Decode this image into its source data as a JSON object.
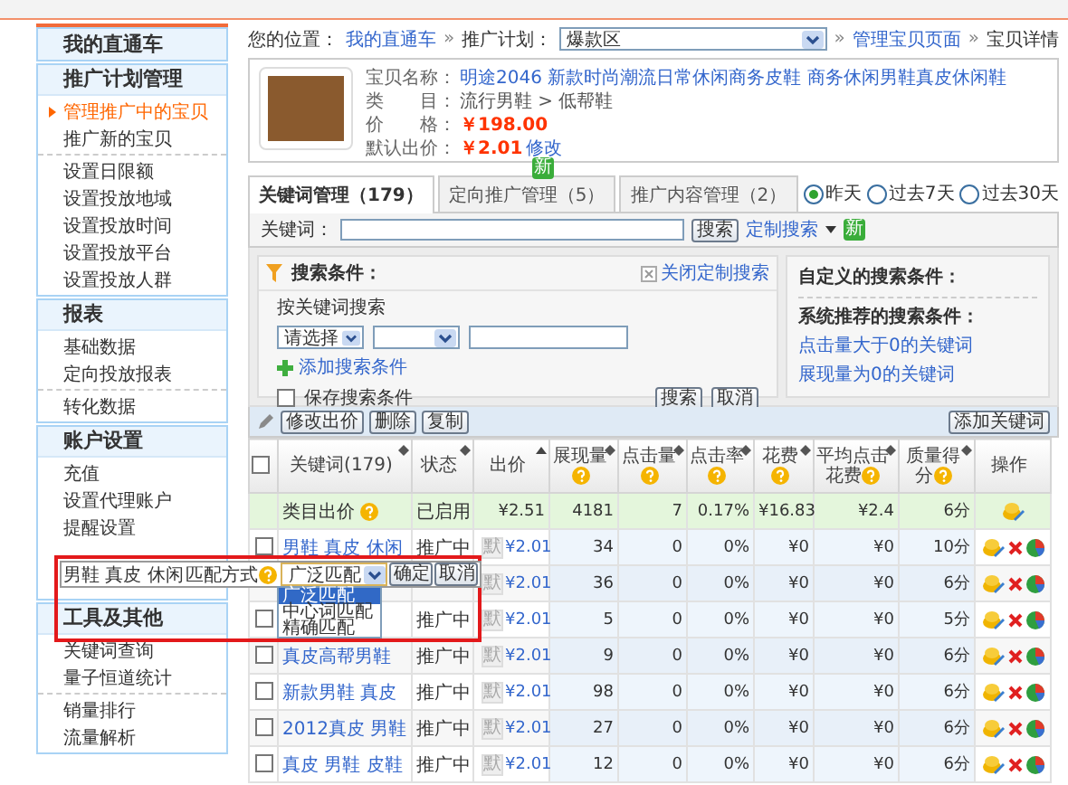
{
  "sidebar": {
    "title": "我的直通车",
    "sections": [
      {
        "title": "推广计划管理",
        "groups": [
          {
            "items": [
              {
                "label": "管理推广中的宝贝",
                "selected": true
              },
              {
                "label": "推广新的宝贝",
                "selected": false
              }
            ]
          },
          {
            "items": [
              {
                "label": "设置日限额",
                "selected": false
              },
              {
                "label": "设置投放地域",
                "selected": false
              },
              {
                "label": "设置投放时间",
                "selected": false
              },
              {
                "label": "设置投放平台",
                "selected": false
              },
              {
                "label": "设置投放人群",
                "selected": false
              }
            ]
          }
        ]
      },
      {
        "title": "报表",
        "groups": [
          {
            "items": [
              {
                "label": "基础数据",
                "selected": false
              },
              {
                "label": "定向投放报表",
                "selected": false
              }
            ]
          },
          {
            "items": [
              {
                "label": "转化数据",
                "selected": false
              }
            ]
          }
        ]
      },
      {
        "title": "账户设置",
        "groups": [
          {
            "items": [
              {
                "label": "充值",
                "selected": false
              },
              {
                "label": "设置代理账户",
                "selected": false
              },
              {
                "label": "提醒设置",
                "selected": false
              }
            ]
          }
        ]
      },
      {
        "title": "工具及其他",
        "groups": [
          {
            "items": [
              {
                "label": "关键词查询",
                "selected": false
              },
              {
                "label": "量子恒道统计",
                "selected": false
              }
            ]
          },
          {
            "items": [
              {
                "label": "销量排行",
                "selected": false
              },
              {
                "label": "流量解析",
                "selected": false
              }
            ]
          }
        ]
      }
    ]
  },
  "breadcrumb": [
    {
      "kind": "text",
      "text": "您的位置："
    },
    {
      "kind": "link",
      "text": "我的直通车"
    },
    {
      "kind": "sep",
      "text": "»"
    },
    {
      "kind": "text",
      "text": "推广计划："
    },
    {
      "kind": "select",
      "text": "爆款区"
    },
    {
      "kind": "sep",
      "text": "»"
    },
    {
      "kind": "link",
      "text": "管理宝贝页面"
    },
    {
      "kind": "sep",
      "text": "»"
    },
    {
      "kind": "text",
      "text": "宝贝详情"
    }
  ],
  "product": {
    "fields": [
      {
        "label": "宝贝名称：",
        "value": "明途2046 新款时尚潮流日常休闲商务皮鞋 商务休闲男鞋真皮休闲鞋",
        "kind": "link"
      },
      {
        "label": "类　　目：",
        "value": "流行男鞋 > 低帮鞋",
        "kind": "text"
      },
      {
        "label": "价　　格：",
        "value": "￥198.00",
        "kind": "price"
      },
      {
        "label": "默认出价：",
        "value": "￥2.01",
        "kind": "price",
        "action": "修改"
      }
    ]
  },
  "tabs": [
    {
      "label": "关键词管理（179）",
      "selected": true
    },
    {
      "label": "定向推广管理（5）",
      "selected": false,
      "badge": "新"
    },
    {
      "label": "推广内容管理（2）",
      "selected": false
    }
  ],
  "periods": [
    {
      "label": "昨天",
      "selected": true
    },
    {
      "label": "过去7天",
      "selected": false
    },
    {
      "label": "过去30天",
      "selected": false
    }
  ],
  "search": {
    "label": "关键词：",
    "button": "搜索",
    "custom_link": "定制搜索",
    "badge": "新"
  },
  "conditions": {
    "title": "搜索条件：",
    "close_link": "关闭定制搜索",
    "by_keyword": "按关键词搜索",
    "select": "请选择",
    "add_link": "添加搜索条件",
    "save": {
      "label": "保存搜索条件",
      "checked": false
    },
    "buttons": [
      "搜索",
      "取消"
    ],
    "custom_title": "自定义的搜索条件：",
    "recommended_title": "系统推荐的搜索条件：",
    "links": [
      "点击量大于0的关键词",
      "展现量为0的关键词"
    ]
  },
  "toolbar": {
    "buttons": [
      "修改出价",
      "删除",
      "复制"
    ],
    "add_button": "添加关键词"
  },
  "table": {
    "all_checked": false,
    "columns": [
      {
        "label": "关键词(179)",
        "sort": true,
        "help": false
      },
      {
        "label": "状态",
        "sort": true,
        "help": false
      },
      {
        "label": "出价",
        "sort": true,
        "help": false
      },
      {
        "label": "展现量",
        "sort": true,
        "help": true
      },
      {
        "label": "点击量",
        "sort": true,
        "help": true
      },
      {
        "label": "点击率",
        "sort": true,
        "help": true
      },
      {
        "label": "花费",
        "sort": true,
        "help": true
      },
      {
        "label": "平均点击花费",
        "sort": true,
        "help": true
      },
      {
        "label": "质量得分",
        "sort": true,
        "help": true
      },
      {
        "label": "操作",
        "sort": false,
        "help": false
      }
    ],
    "rows": [
      {
        "kind": "category",
        "name": "类目出价",
        "status": "已启用",
        "bid": "¥2.51",
        "impressions": "4181",
        "clicks": "7",
        "ctr": "0.17%",
        "cost": "¥16.83",
        "cpc": "¥2.4",
        "quality": "6分"
      },
      {
        "kind": "keyword",
        "checked": false,
        "name": "男鞋 真皮 休闲",
        "status": "推广中",
        "tag": "默",
        "bid": "¥2.01",
        "impressions": "34",
        "clicks": "0",
        "ctr": "0%",
        "cost": "¥0",
        "cpc": "¥0",
        "quality": "10分"
      },
      {
        "kind": "keyword",
        "tag": "默",
        "bid": "¥2.01",
        "impressions": "36",
        "clicks": "0",
        "ctr": "0%",
        "cost": "¥0",
        "cpc": "¥0",
        "quality": "6分"
      },
      {
        "kind": "keyword",
        "checked": false,
        "status": "推广中",
        "tag": "默",
        "bid": "¥2.01",
        "impressions": "5",
        "clicks": "0",
        "ctr": "0%",
        "cost": "¥0",
        "cpc": "¥0",
        "quality": "5分"
      },
      {
        "kind": "keyword",
        "checked": false,
        "name": "真皮高帮男鞋",
        "status": "推广中",
        "tag": "默",
        "bid": "¥2.01",
        "impressions": "9",
        "clicks": "0",
        "ctr": "0%",
        "cost": "¥0",
        "cpc": "¥0",
        "quality": "6分"
      },
      {
        "kind": "keyword",
        "checked": false,
        "name": "新款男鞋 真皮",
        "status": "推广中",
        "tag": "默",
        "bid": "¥2.01",
        "impressions": "98",
        "clicks": "0",
        "ctr": "0%",
        "cost": "¥0",
        "cpc": "¥0",
        "quality": "6分"
      },
      {
        "kind": "keyword",
        "checked": false,
        "name": "2012真皮 男鞋",
        "status": "推广中",
        "tag": "默",
        "bid": "¥2.01",
        "impressions": "27",
        "clicks": "0",
        "ctr": "0%",
        "cost": "¥0",
        "cpc": "¥0",
        "quality": "6分"
      },
      {
        "kind": "keyword",
        "checked": false,
        "name": "真皮 男鞋 皮鞋",
        "status": "推广中",
        "tag": "默",
        "bid": "¥2.01",
        "impressions": "12",
        "clicks": "0",
        "ctr": "0%",
        "cost": "¥0",
        "cpc": "¥0",
        "quality": "6分"
      }
    ]
  },
  "popup": {
    "text": "男鞋 真皮 休闲",
    "label": "匹配方式",
    "select": "广泛匹配",
    "options": [
      {
        "label": "广泛匹配",
        "selected": true
      },
      {
        "label": "中心词匹配",
        "selected": false
      },
      {
        "label": "精确匹配",
        "selected": false
      }
    ],
    "buttons": [
      "确定",
      "取消"
    ]
  }
}
